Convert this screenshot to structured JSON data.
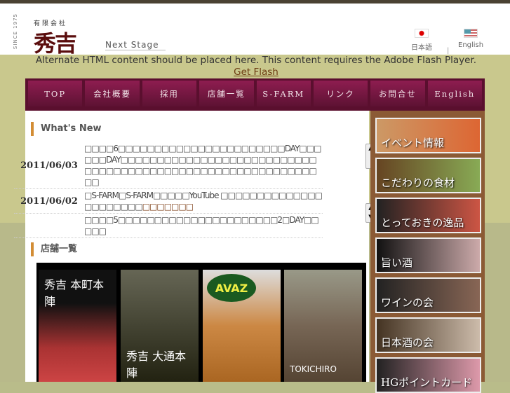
{
  "header": {
    "since": "SINCE 1975",
    "corp": "有限会社",
    "logo": "秀吉",
    "tagline": "Next Stage",
    "lang_ja": "日本語",
    "lang_sep": "|",
    "lang_en": "English"
  },
  "flash": {
    "text": "Alternate HTML content should be placed here. This content requires the Adobe Flash Player. ",
    "link": "Get Flash"
  },
  "nav": [
    "TOP",
    "会社概要",
    "採用",
    "店舗一覧",
    "S-FARM",
    "リンク",
    "お問合せ",
    "English"
  ],
  "whats_new": {
    "title": "What's New",
    "items": [
      {
        "date": "2011/06/03",
        "text": "□□□□6□□□□□□□□□□□□□□□□□□□□□□□DAY□□□□□□DAY□□□□□□□□□□□□□□□□□□□□□□□□□□□□□□□□□□□□□□□□□□□□□□□□□□□□□□□□□□□□□",
        "link": ""
      },
      {
        "date": "2011/06/02",
        "text": "□S-FARM□S-FARM□□□□□YouTube □□□□□□□□□□□□□□□□□□□□□□",
        "link": "□□□□□□□"
      },
      {
        "date": "",
        "text": "□□□□5□□□□□□□□□□□□□□□□□□□□□□2□DAY□□□□□",
        "link": ""
      }
    ]
  },
  "shops": {
    "title": "店舗一覧",
    "items": [
      "秀吉 本町本陣",
      "秀吉 大通本陣",
      "AVAZ",
      "TOKICHIRO"
    ]
  },
  "sidebar": [
    "イベント情報",
    "こだわりの食材",
    "とっておきの逸品",
    "旨い酒",
    "ワインの会",
    "日本酒の会",
    "HGポイントカード"
  ],
  "colors": {
    "nav": "#5a0f2e",
    "accent": "#d38d35",
    "sidebar": "#8b5a35"
  }
}
